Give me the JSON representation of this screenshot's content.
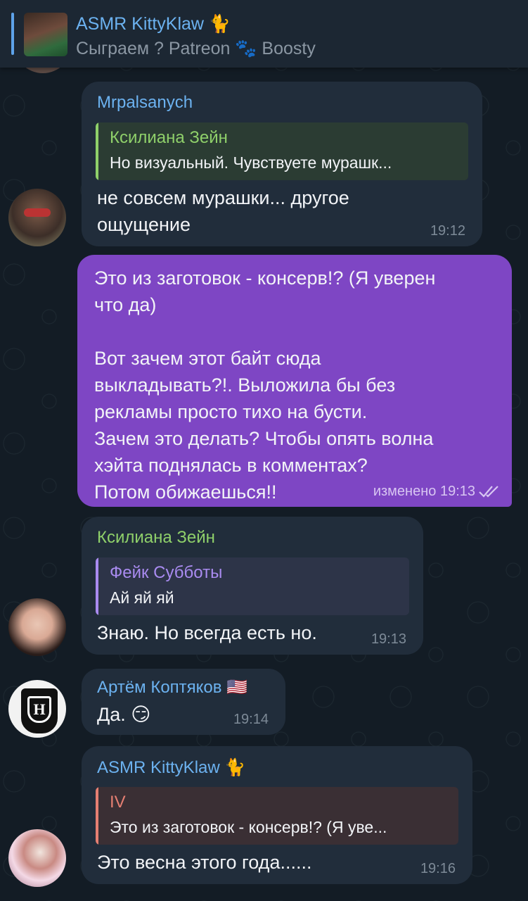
{
  "pinned": {
    "title": "ASMR KittyKlaw 🐈",
    "subtitle": "Сыграем ? Patreon 🐾 Boosty"
  },
  "messages": [
    {
      "sender": "Mrpalsanych",
      "quote_name": "Ксилиана Зейн",
      "quote_text": "Но визуальный. Чувствуете мурашк...",
      "text": "не совсем мурашки... другое\nощущение",
      "time": "19:12"
    },
    {
      "outgoing": true,
      "text": "Это из заготовок - консерв!? (Я уверен\nчто да)\n\nВот зачем этот байт сюда\nвыкладывать?!. Выложила бы без\nрекламы просто тихо на бусти.\nЗачем это делать? Чтобы опять волна\nхэйта поднялась в комментах?\nПотом обижаешься!!",
      "time": "изменено 19:13"
    },
    {
      "sender": "Ксилиана Зейн",
      "quote_name": "Фейк Субботы",
      "quote_text": "Ай яй яй",
      "text": "Знаю. Но всегда есть но.",
      "time": "19:13"
    },
    {
      "sender": "Артём Коптяков 🇺🇸",
      "text": "Да. 😏",
      "time": "19:14"
    },
    {
      "sender": "ASMR KittyKlaw 🐈",
      "quote_name": "IV",
      "quote_text": "Это из заготовок - консерв!? (Я уве...",
      "text": "Это весна этого года......",
      "time": "19:16"
    }
  ],
  "colors": {
    "background": "#131c25",
    "bubble_in": "#212d3b",
    "bubble_out": "#7e46c4",
    "name_blue": "#6cb2f0",
    "name_green": "#8fd06a",
    "name_purple": "#a98bf0",
    "name_red": "#e57f72"
  }
}
